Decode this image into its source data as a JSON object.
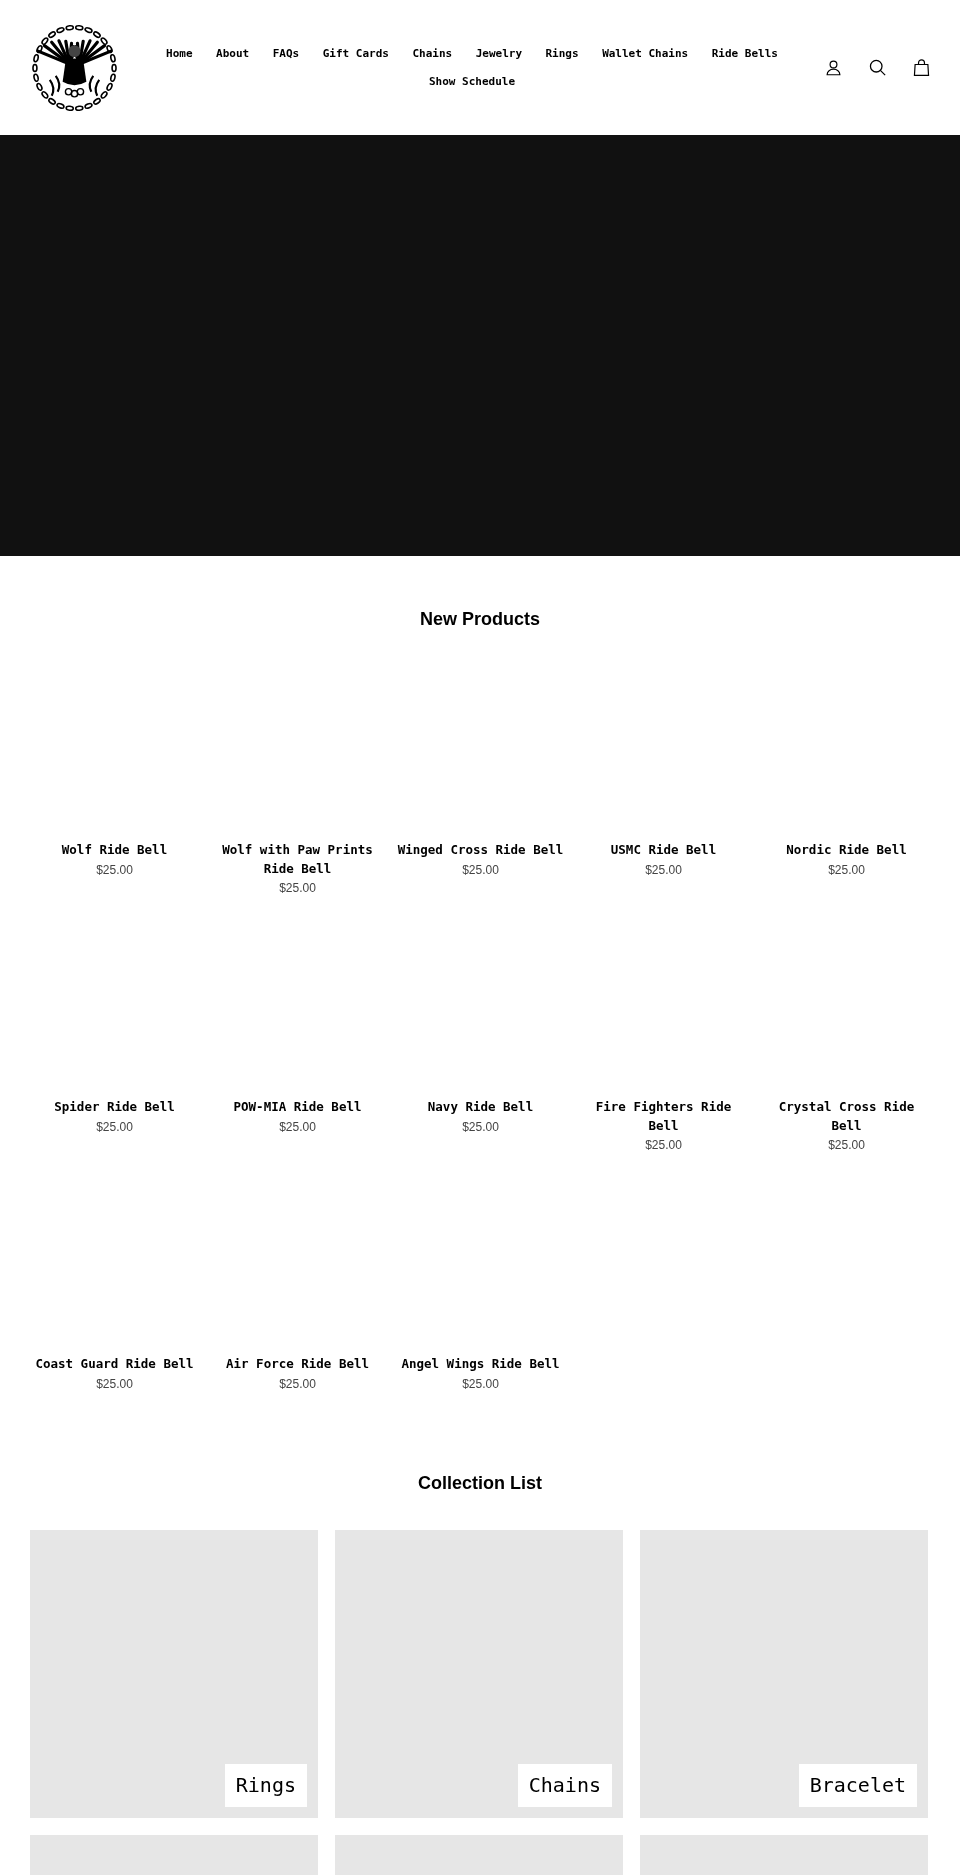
{
  "header": {
    "nav": [
      "Home",
      "About",
      "FAQs",
      "Gift Cards",
      "Chains",
      "Jewelry",
      "Rings",
      "Wallet Chains",
      "Ride Bells",
      "Show Schedule"
    ]
  },
  "products": {
    "title": "New Products",
    "items": [
      {
        "name": "Wolf Ride Bell",
        "price": "$25.00"
      },
      {
        "name": "Wolf with Paw Prints Ride Bell",
        "price": "$25.00"
      },
      {
        "name": "Winged Cross Ride Bell",
        "price": "$25.00"
      },
      {
        "name": "USMC Ride Bell",
        "price": "$25.00"
      },
      {
        "name": "Nordic Ride Bell",
        "price": "$25.00"
      },
      {
        "name": "Spider Ride Bell",
        "price": "$25.00"
      },
      {
        "name": "POW-MIA Ride Bell",
        "price": "$25.00"
      },
      {
        "name": "Navy Ride Bell",
        "price": "$25.00"
      },
      {
        "name": "Fire Fighters Ride Bell",
        "price": "$25.00"
      },
      {
        "name": "Crystal Cross Ride Bell",
        "price": "$25.00"
      },
      {
        "name": "Coast Guard Ride Bell",
        "price": "$25.00"
      },
      {
        "name": "Air Force Ride Bell",
        "price": "$25.00"
      },
      {
        "name": "Angel Wings Ride Bell",
        "price": "$25.00"
      }
    ]
  },
  "collections": {
    "title": "Collection List",
    "items": [
      {
        "kind": "labeled",
        "label": "Rings"
      },
      {
        "kind": "labeled",
        "label": "Chains"
      },
      {
        "kind": "labeled",
        "label": "Bracelet"
      },
      {
        "kind": "plain"
      },
      {
        "kind": "plain"
      },
      {
        "kind": "plain"
      }
    ]
  }
}
